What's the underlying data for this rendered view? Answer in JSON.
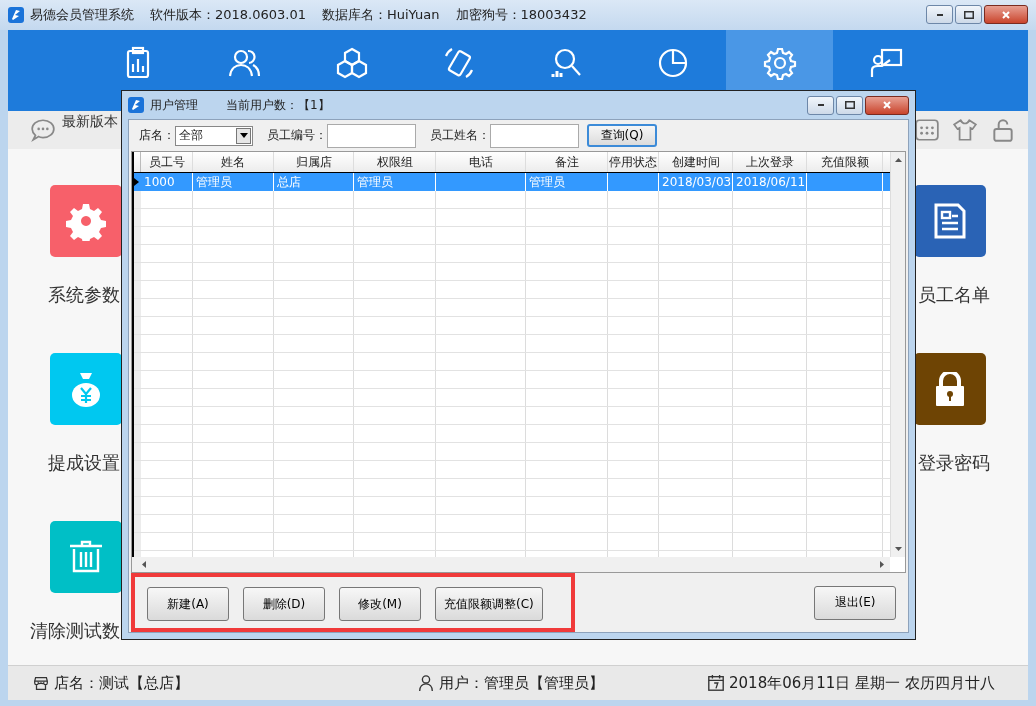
{
  "window": {
    "title": "易德会员管理系统",
    "version": "软件版本：2018.0603.01",
    "database": "数据库名：HuiYuan",
    "dongle": "加密狗号：18003432"
  },
  "nav": [
    {
      "kind": "clipboard",
      "selected": false
    },
    {
      "kind": "people",
      "selected": false
    },
    {
      "kind": "cubes",
      "selected": false
    },
    {
      "kind": "phone",
      "selected": false
    },
    {
      "kind": "search",
      "selected": false
    },
    {
      "kind": "pie",
      "selected": false
    },
    {
      "kind": "gear",
      "selected": true
    },
    {
      "kind": "screen",
      "selected": false
    }
  ],
  "subbar": {
    "notice": "最新版本"
  },
  "tiles_left": [
    {
      "kind": "gear",
      "label": "系统参数",
      "color": "#f7606a"
    },
    {
      "kind": "moneybag",
      "label": "提成设置",
      "color": "#00c8f0"
    },
    {
      "kind": "trash",
      "label": "清除测试数",
      "color": "#00bfc6"
    }
  ],
  "tiles_right": [
    {
      "kind": "document",
      "label": "员工名单",
      "color": "#2a63b5"
    },
    {
      "kind": "lock",
      "label": "登录密码",
      "color": "#6e4404"
    }
  ],
  "dialog": {
    "title": "用户管理",
    "user_count": "当前用户数：【1】",
    "filters": {
      "store_label": "店名：",
      "store_value": "全部",
      "id_label": "员工编号：",
      "name_label": "员工姓名：",
      "query_button": "查询(Q)"
    },
    "table": {
      "columns": [
        "员工号",
        "姓名",
        "归属店",
        "权限组",
        "电话",
        "备注",
        "停用状态",
        "创建时间",
        "上次登录",
        "充值限额"
      ],
      "rows": [
        {
          "selected": true,
          "cells": [
            "1000",
            "管理员",
            "总店",
            "管理员",
            null,
            "管理员",
            null,
            "2018/03/03",
            "2018/06/11",
            null
          ]
        }
      ]
    },
    "buttons": [
      "新建(A)",
      "删除(D)",
      "修改(M)",
      "充值限额调整(C)"
    ],
    "exit_button": "退出(E)"
  },
  "status_bar": {
    "store": "店名：测试【总店】",
    "user": "用户：管理员【管理员】",
    "date": "2018年06月11日 星期一 农历四月廿八"
  }
}
